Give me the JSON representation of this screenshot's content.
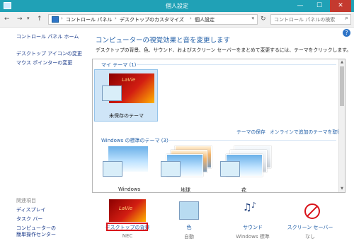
{
  "window": {
    "title": "個人設定",
    "minimize": "—",
    "maximize": "☐",
    "close": "✕"
  },
  "addressbar": {
    "back": "←",
    "forward": "→",
    "up": "↑",
    "crumbs": [
      "コントロール パネル",
      "デスクトップのカスタマイズ",
      "個人設定"
    ],
    "refresh": "↻",
    "search_placeholder": "コントロール パネルの検索"
  },
  "help": "?",
  "sidebar": {
    "home": "コントロール パネル ホーム",
    "links": [
      "デスクトップ アイコンの変更",
      "マウス ポインターの変更"
    ],
    "related_heading": "関連項目",
    "related": [
      "ディスプレイ",
      "タスク バー",
      "コンピューターの",
      "簡単操作センター"
    ]
  },
  "main": {
    "heading": "コンピューターの視覚効果と音を変更します",
    "subheading": "デスクトップの背景、色、サウンド、およびスクリーン セーバーをまとめて変更するには、テーマをクリックします。",
    "my_themes_label": "マイ テーマ (1)",
    "unsaved_theme_label": "未保存のテーマ",
    "unsaved_brand": "LaVie",
    "save_theme_link": "テーマの保存",
    "get_more_link": "オンラインで追加のテーマを取得",
    "windows_themes_label": "Windows の標準のテーマ (3)",
    "windows_themes": [
      "Windows",
      "地球",
      "花"
    ]
  },
  "bottom": {
    "desktop_bg": {
      "label": "デスクトップの背景",
      "value": "NEC",
      "brand": "LaVie"
    },
    "color": {
      "label": "色",
      "value": "自動"
    },
    "sound": {
      "label": "サウンド",
      "value": "Windows 標準"
    },
    "screensaver": {
      "label": "スクリーン セーバー",
      "value": "なし"
    }
  }
}
